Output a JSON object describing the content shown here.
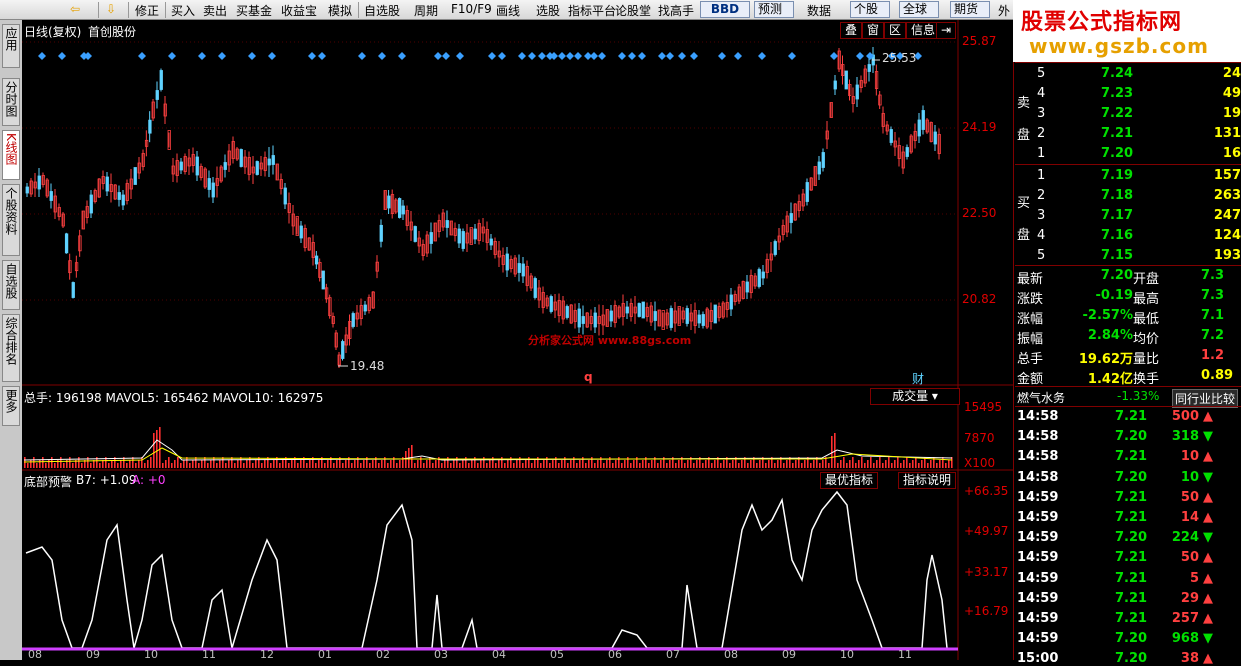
{
  "toolbar": {
    "items": [
      "修正",
      "买入",
      "卖出",
      "买基金",
      "收益宝",
      "模拟",
      "自选股",
      "周期",
      "F10/F9",
      "画线",
      "选股",
      "指标平台",
      "论股堂",
      "找高手",
      "BBD",
      "预测",
      "数据",
      "个股",
      "全球",
      "期货",
      "外"
    ]
  },
  "logo": {
    "line1": "股票公式指标网",
    "line2": "www.gszb.com"
  },
  "sidebar": {
    "tabs": [
      "应用",
      "分时图",
      "K线图",
      "个股资料",
      "自选股",
      "综合排名",
      "更多"
    ],
    "active": "K线图"
  },
  "main_panel": {
    "title": "日线(复权)",
    "stock_name": "首创股份",
    "header_buttons": [
      "叠",
      "窗",
      "区",
      "信息"
    ],
    "price_axis": [
      "25.87",
      "24.19",
      "22.50",
      "20.82"
    ],
    "high_label": "25.53",
    "low_label": "19.48",
    "watermark": "分析家公式网 www.88gs.com",
    "q_marker": "q",
    "cai_marker": "财"
  },
  "volume_panel": {
    "title": "总手: 196198 MAVOL5: 165462 MAVOL10: 162975",
    "select_label": "成交量",
    "axis": [
      "15495",
      "7870",
      "X100"
    ]
  },
  "indicator_panel": {
    "title_name": "底部预警",
    "title_b7": "B7: +1.09",
    "title_a": "A: +0",
    "buttons": [
      "最优指标",
      "指标说明"
    ],
    "axis": [
      "+66.35",
      "+49.97",
      "+33.17",
      "+16.79"
    ],
    "months": [
      "08",
      "09",
      "10",
      "11",
      "12",
      "01",
      "02",
      "03",
      "04",
      "05",
      "06",
      "07",
      "08",
      "09",
      "10",
      "11"
    ]
  },
  "quote": {
    "sell": [
      {
        "level": "5",
        "price": "7.24",
        "vol": "24"
      },
      {
        "level": "4",
        "price": "7.23",
        "vol": "49"
      },
      {
        "level": "3",
        "price": "7.22",
        "vol": "19"
      },
      {
        "level": "2",
        "price": "7.21",
        "vol": "131"
      },
      {
        "level": "1",
        "price": "7.20",
        "vol": "16"
      }
    ],
    "buy": [
      {
        "level": "1",
        "price": "7.19",
        "vol": "157"
      },
      {
        "level": "2",
        "price": "7.18",
        "vol": "263"
      },
      {
        "level": "3",
        "price": "7.17",
        "vol": "247"
      },
      {
        "level": "4",
        "price": "7.16",
        "vol": "124"
      },
      {
        "level": "5",
        "price": "7.15",
        "vol": "193"
      }
    ],
    "sell_label": [
      "卖",
      "盘"
    ],
    "buy_label": [
      "买",
      "盘"
    ],
    "stats": [
      {
        "k": "最新",
        "v": "7.20",
        "k2": "开盘",
        "v2": "7.3"
      },
      {
        "k": "涨跌",
        "v": "-0.19",
        "k2": "最高",
        "v2": "7.3"
      },
      {
        "k": "涨幅",
        "v": "-2.57%",
        "k2": "最低",
        "v2": "7.1"
      },
      {
        "k": "振幅",
        "v": "2.84%",
        "k2": "均价",
        "v2": "7.2"
      },
      {
        "k": "总手",
        "v": "19.62万",
        "k2": "量比",
        "v2": "1.2"
      },
      {
        "k": "金额",
        "v": "1.42亿",
        "k2": "换手",
        "v2": "0.89"
      }
    ],
    "sector": {
      "name": "燃气水务",
      "change": "-1.33%",
      "compare": "同行业比较"
    },
    "ticks": [
      {
        "t": "14:58",
        "p": "7.21",
        "v": "500",
        "d": "up"
      },
      {
        "t": "14:58",
        "p": "7.20",
        "v": "318",
        "d": "dn"
      },
      {
        "t": "14:58",
        "p": "7.21",
        "v": "10",
        "d": "up"
      },
      {
        "t": "14:58",
        "p": "7.20",
        "v": "10",
        "d": "dn"
      },
      {
        "t": "14:59",
        "p": "7.21",
        "v": "50",
        "d": "up"
      },
      {
        "t": "14:59",
        "p": "7.21",
        "v": "14",
        "d": "up"
      },
      {
        "t": "14:59",
        "p": "7.20",
        "v": "224",
        "d": "dn"
      },
      {
        "t": "14:59",
        "p": "7.21",
        "v": "50",
        "d": "up"
      },
      {
        "t": "14:59",
        "p": "7.21",
        "v": "5",
        "d": "up"
      },
      {
        "t": "14:59",
        "p": "7.21",
        "v": "29",
        "d": "up"
      },
      {
        "t": "14:59",
        "p": "7.21",
        "v": "257",
        "d": "up"
      },
      {
        "t": "14:59",
        "p": "7.20",
        "v": "968",
        "d": "dn"
      },
      {
        "t": "15:00",
        "p": "7.20",
        "v": "38",
        "d": "up"
      }
    ]
  },
  "colors": {
    "up": "#ff4040",
    "down": "#5fd3ff",
    "axis": "#e00000",
    "diamond": "#3aa0ff",
    "volume_up": "#ff3030",
    "indicator": "#ffffff",
    "baseline": "#d040ff"
  }
}
